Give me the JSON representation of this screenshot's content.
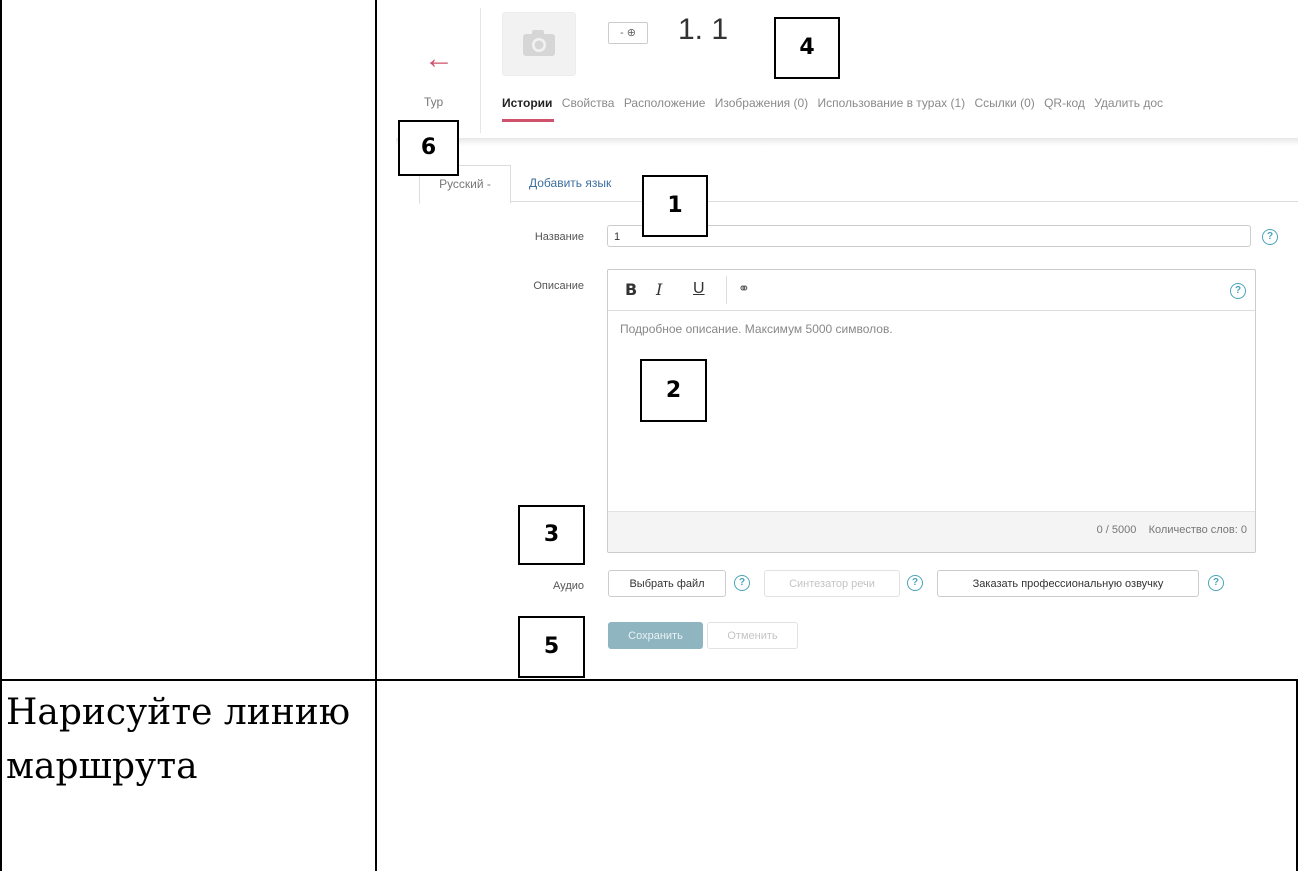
{
  "document": {
    "task_text": "Нарисуйте линию маршрута"
  },
  "screenshot": {
    "header": {
      "tour_label": "Тур",
      "lang_switch": "- ⊕",
      "title": "1. 1",
      "tabs": [
        "Истории",
        "Свойства",
        "Расположение",
        "Изображения (0)",
        "Использование в турах (1)",
        "Ссылки (0)",
        "QR-код",
        "Удалить дос"
      ]
    },
    "lang_tabs": {
      "current": "Русский -",
      "add": "Добавить язык"
    },
    "form": {
      "name_label": "Название",
      "name_value": "1",
      "description_label": "Описание",
      "toolbar": {
        "bold": "B",
        "italic": "I",
        "underline": "U",
        "link": "🔗"
      },
      "description_placeholder": "Подробное описание. Максимум 5000 символов.",
      "char_count": "0 / 5000",
      "word_count": "Количество слов: 0",
      "audio_label": "Аудио",
      "choose_file": "Выбрать файл",
      "speech_synth": "Синтезатор речи",
      "order_voiceover": "Заказать профессиональную озвучку",
      "save": "Сохранить",
      "cancel": "Отменить"
    },
    "annotations": {
      "a1": "1",
      "a2": "2",
      "a3": "3",
      "a4": "4",
      "a5": "5",
      "a6": "6"
    }
  }
}
